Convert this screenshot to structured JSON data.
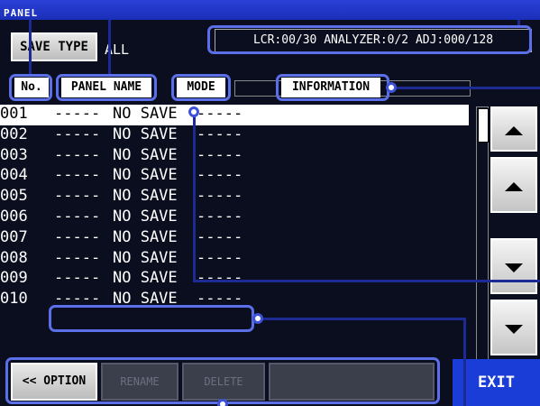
{
  "window": {
    "title": "PANEL"
  },
  "toolbar": {
    "save_type_label": "SAVE TYPE",
    "save_type_value": "ALL"
  },
  "status": {
    "text": "LCR:00/30  ANALYZER:0/2  ADJ:000/128"
  },
  "columns": {
    "no": "No.",
    "panel_name": "PANEL NAME",
    "mode": "MODE",
    "information": "INFORMATION"
  },
  "rows": [
    {
      "no": "001",
      "name": "-----",
      "mode": "NO SAVE",
      "info": "-----"
    },
    {
      "no": "002",
      "name": "-----",
      "mode": "NO SAVE",
      "info": "-----"
    },
    {
      "no": "003",
      "name": "-----",
      "mode": "NO SAVE",
      "info": "-----"
    },
    {
      "no": "004",
      "name": "-----",
      "mode": "NO SAVE",
      "info": "-----"
    },
    {
      "no": "005",
      "name": "-----",
      "mode": "NO SAVE",
      "info": "-----"
    },
    {
      "no": "006",
      "name": "-----",
      "mode": "NO SAVE",
      "info": "-----"
    },
    {
      "no": "007",
      "name": "-----",
      "mode": "NO SAVE",
      "info": "-----"
    },
    {
      "no": "008",
      "name": "-----",
      "mode": "NO SAVE",
      "info": "-----"
    },
    {
      "no": "009",
      "name": "-----",
      "mode": "NO SAVE",
      "info": "-----"
    },
    {
      "no": "010",
      "name": "-----",
      "mode": "NO SAVE",
      "info": "-----"
    }
  ],
  "bottom": {
    "option_label": "<< OPTION",
    "rename_label": "RENAME",
    "delete_label": "DELETE",
    "exit_label": "EXIT"
  },
  "colors": {
    "title_bar": "#1a2fb8",
    "background": "#0a0e1e",
    "callout": "#5b6fe8",
    "exit_button": "#1a3dd8"
  }
}
